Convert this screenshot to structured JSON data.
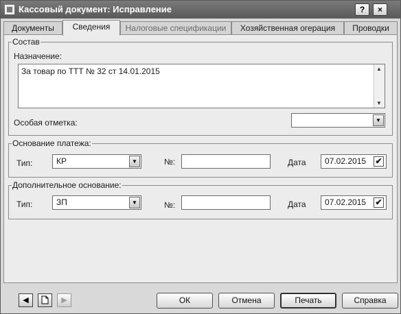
{
  "window": {
    "title": "Кассовый документ: Исправление",
    "help_button": "?",
    "close_button": "×"
  },
  "tabs": [
    {
      "label": "Документы"
    },
    {
      "label": "Сведения"
    },
    {
      "label": "Налоговые спецификации"
    },
    {
      "label": "Хозяйственная огерация"
    },
    {
      "label": "Проводки"
    }
  ],
  "active_tab": "Сведения",
  "composition": {
    "legend": "Состав",
    "purpose_label": "Назначение:",
    "purpose_value": "За товар по ТТТ № 32 ст 14.01.2015",
    "special_mark_label": "Особая отметка:",
    "special_mark_value": ""
  },
  "payment_basis": {
    "legend": "Основание платежа:",
    "type_label": "Тип:",
    "type_value": "КР",
    "number_label": "№:",
    "number_value": "",
    "date_label": "Дата",
    "date_value": "07.02.2015",
    "date_checked": true
  },
  "additional_basis": {
    "legend": "Дополнительное основание:",
    "type_label": "Тип:",
    "type_value": "ЗП",
    "number_label": "№:",
    "number_value": "",
    "date_label": "Дата",
    "date_value": "07.02.2015",
    "date_checked": true
  },
  "footer": {
    "ok": "ОК",
    "cancel": "Отмена",
    "print": "Печать",
    "help": "Справка"
  },
  "icons": {
    "back": "back-arrow-icon",
    "new_document": "document-icon",
    "forward": "forward-arrow-icon"
  }
}
